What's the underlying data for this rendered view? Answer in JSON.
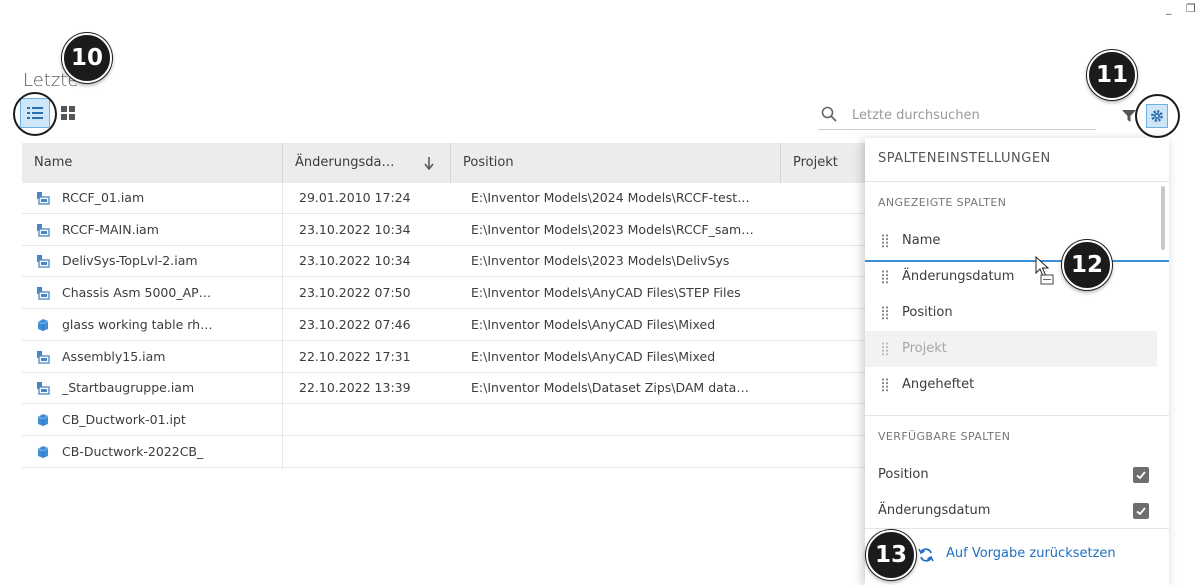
{
  "window": {
    "minimize_glyph": "_",
    "restore_glyph": "❐"
  },
  "page": {
    "title": "Letzte"
  },
  "search": {
    "placeholder": "Letzte durchsuchen"
  },
  "table": {
    "columns": [
      "Name",
      "Änderungsda…",
      "Position",
      "Projekt"
    ],
    "sort_column": "Änderungsda…",
    "sort_direction": "descending",
    "rows": [
      {
        "name": "RCCF_01.iam",
        "icon": "assembly-icon",
        "date": "29.01.2010 17:24",
        "position": "E:\\Inventor Models\\2024 Models\\RCCF-test…"
      },
      {
        "name": "RCCF-MAIN.iam",
        "icon": "assembly-icon",
        "date": "23.10.2022 10:34",
        "position": "E:\\Inventor Models\\2023 Models\\RCCF_sam…"
      },
      {
        "name": "DelivSys-TopLvl-2.iam",
        "icon": "assembly-icon",
        "date": "23.10.2022 10:34",
        "position": "E:\\Inventor Models\\2023 Models\\DelivSys"
      },
      {
        "name": "Chassis Asm 5000_AP…",
        "icon": "assembly-icon",
        "date": "23.10.2022 07:50",
        "position": "E:\\Inventor Models\\AnyCAD Files\\STEP Files"
      },
      {
        "name": "glass working table rh…",
        "icon": "part-icon",
        "date": "23.10.2022 07:46",
        "position": "E:\\Inventor Models\\AnyCAD Files\\Mixed"
      },
      {
        "name": "Assembly15.iam",
        "icon": "assembly-icon",
        "date": "22.10.2022 17:31",
        "position": "E:\\Inventor Models\\AnyCAD Files\\Mixed"
      },
      {
        "name": "_Startbaugruppe.iam",
        "icon": "assembly-icon",
        "date": "22.10.2022 13:39",
        "position": "E:\\Inventor Models\\Dataset Zips\\DAM data…"
      },
      {
        "name": "CB_Ductwork-01.ipt",
        "icon": "part-icon",
        "date": "",
        "position": ""
      },
      {
        "name": "CB-Ductwork-2022CB_",
        "icon": "part-icon",
        "date": "",
        "position": ""
      }
    ]
  },
  "column_settings": {
    "title": "SPALTENEINSTELLUNGEN",
    "shown_section": "ANGEZEIGTE SPALTEN",
    "shown_columns": [
      {
        "label": "Name",
        "enabled": true
      },
      {
        "label": "Änderungsdatum",
        "enabled": true
      },
      {
        "label": "Position",
        "enabled": true
      },
      {
        "label": "Projekt",
        "enabled": false
      },
      {
        "label": "Angeheftet",
        "enabled": true
      }
    ],
    "available_section": "VERFÜGBARE SPALTEN",
    "available_columns": [
      {
        "label": "Position",
        "checked": true
      },
      {
        "label": "Änderungsdatum",
        "checked": true
      }
    ],
    "reset_label": "Auf Vorgabe zurücksetzen"
  },
  "callouts": [
    "10",
    "11",
    "12",
    "13"
  ],
  "colors": {
    "accent": "#3a8fd6",
    "link": "#1f70c1",
    "header_bg": "#ececec",
    "callout": "#1b1b1b"
  }
}
